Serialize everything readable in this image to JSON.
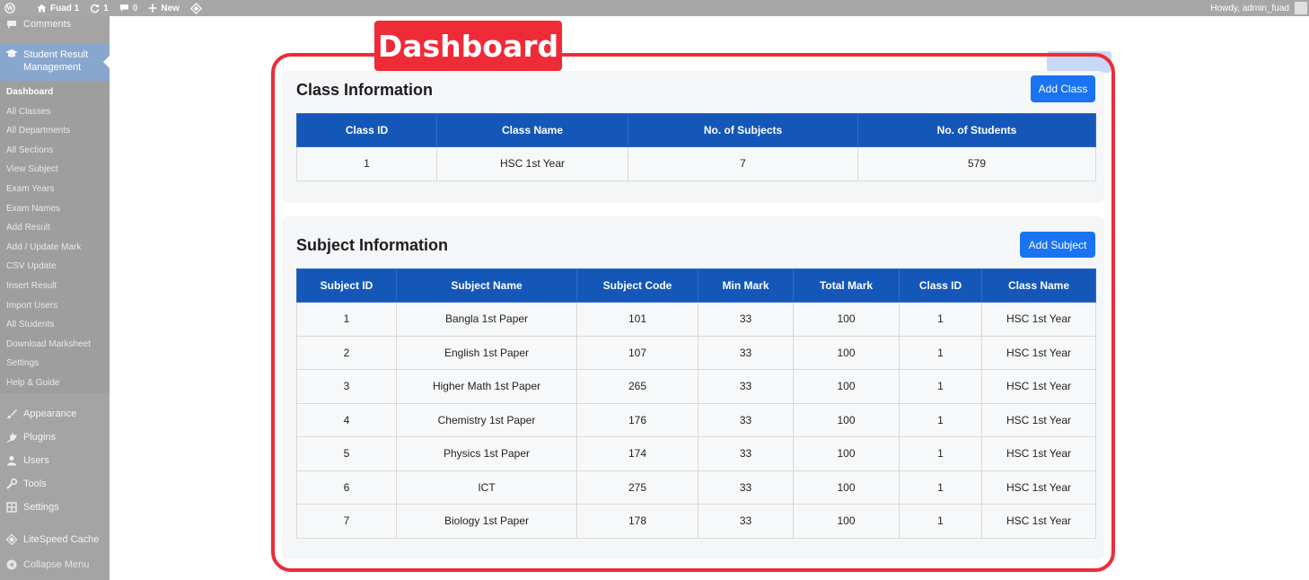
{
  "adminbar": {
    "site_name": "Fuad 1",
    "updates": "1",
    "comments": "0",
    "new_label": "New",
    "greeting": "Howdy, admin_fuad"
  },
  "sidebar": {
    "comments": "Comments",
    "current_menu": "Student Result Management",
    "submenu": [
      "Dashboard",
      "All Classes",
      "All Departments",
      "All Sections",
      "View Subject",
      "Exam Years",
      "Exam Names",
      "Add Result",
      "Add / Update Mark",
      "CSV Update",
      "Insert Result",
      "Import Users",
      "All Students",
      "Download Marksheet",
      "Settings",
      "Help & Guide"
    ],
    "lower": [
      "Appearance",
      "Plugins",
      "Users",
      "Tools",
      "Settings"
    ],
    "litespeed": "LiteSpeed Cache",
    "collapse": "Collapse Menu"
  },
  "tag_label": "Dashboard",
  "class_section": {
    "title": "Class Information",
    "button": "Add Class",
    "headers": [
      "Class ID",
      "Class Name",
      "No. of Subjects",
      "No. of Students"
    ],
    "rows": [
      [
        "1",
        "HSC 1st Year",
        "7",
        "579"
      ]
    ]
  },
  "subject_section": {
    "title": "Subject Information",
    "button": "Add Subject",
    "headers": [
      "Subject ID",
      "Subject Name",
      "Subject Code",
      "Min Mark",
      "Total Mark",
      "Class ID",
      "Class Name"
    ],
    "rows": [
      [
        "1",
        "Bangla 1st Paper",
        "101",
        "33",
        "100",
        "1",
        "HSC 1st Year"
      ],
      [
        "2",
        "English 1st Paper",
        "107",
        "33",
        "100",
        "1",
        "HSC 1st Year"
      ],
      [
        "3",
        "Higher Math 1st Paper",
        "265",
        "33",
        "100",
        "1",
        "HSC 1st Year"
      ],
      [
        "4",
        "Chemistry 1st Paper",
        "176",
        "33",
        "100",
        "1",
        "HSC 1st Year"
      ],
      [
        "5",
        "Physics 1st Paper",
        "174",
        "33",
        "100",
        "1",
        "HSC 1st Year"
      ],
      [
        "6",
        "ICT",
        "275",
        "33",
        "100",
        "1",
        "HSC 1st Year"
      ],
      [
        "7",
        "Biology 1st Paper",
        "178",
        "33",
        "100",
        "1",
        "HSC 1st Year"
      ]
    ]
  },
  "colors": {
    "accent_red": "#ef2b38",
    "table_header": "#1457b8",
    "button_blue": "#1a73f0"
  }
}
